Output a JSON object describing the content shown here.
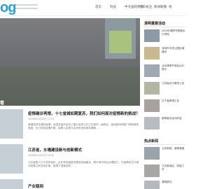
{
  "header": {
    "logo": "og",
    "nav": [
      "首页",
      "科技",
      "中文国际频道",
      "今日关注",
      "新闻联播",
      "地"
    ]
  },
  "banner": {
    "caption": "看"
  },
  "articles": [
    {
      "title": "疫情确诊再增，十七省城如期复苏，我们如何面对疫情新的挑战？",
      "meta": "2020年01月28日 12:00",
      "summary": "遭遇突然来袭的疫情，全国多省市启动了重大突发公共卫生事件一级响应，各地政府和部门采取紧急措施，全力防控疫情扩散，保障人民群众生命安全和身体健康……"
    },
    {
      "title": "江苏省，水墙建设新与创新模式",
      "meta": "2020年01月29日 15:09",
      "summary": "江苏省是人口众多的省份，近年来持续推进基础设施建设，提升城市综合治理能力，在保障民生与推动发展之间寻找平衡，取得了显著成效……"
    },
    {
      "title": "产业链到",
      "meta": "",
      "summary": ""
    }
  ],
  "sidebar": {
    "heading1": "清明重要活动",
    "items1": [
      "2020年清明节假期出行须知",
      "深圳市中央公园区域建设",
      "北京清明节前后出行提示",
      "江苏省出行服务公告",
      "辽宁省新闻汇总",
      "新闻宣传活动内容"
    ],
    "heading2": "热点新闻",
    "items2": [
      "七彩南部，新闻速递",
      "江苏某地区，防疫工作",
      "清明祭扫"
    ]
  }
}
